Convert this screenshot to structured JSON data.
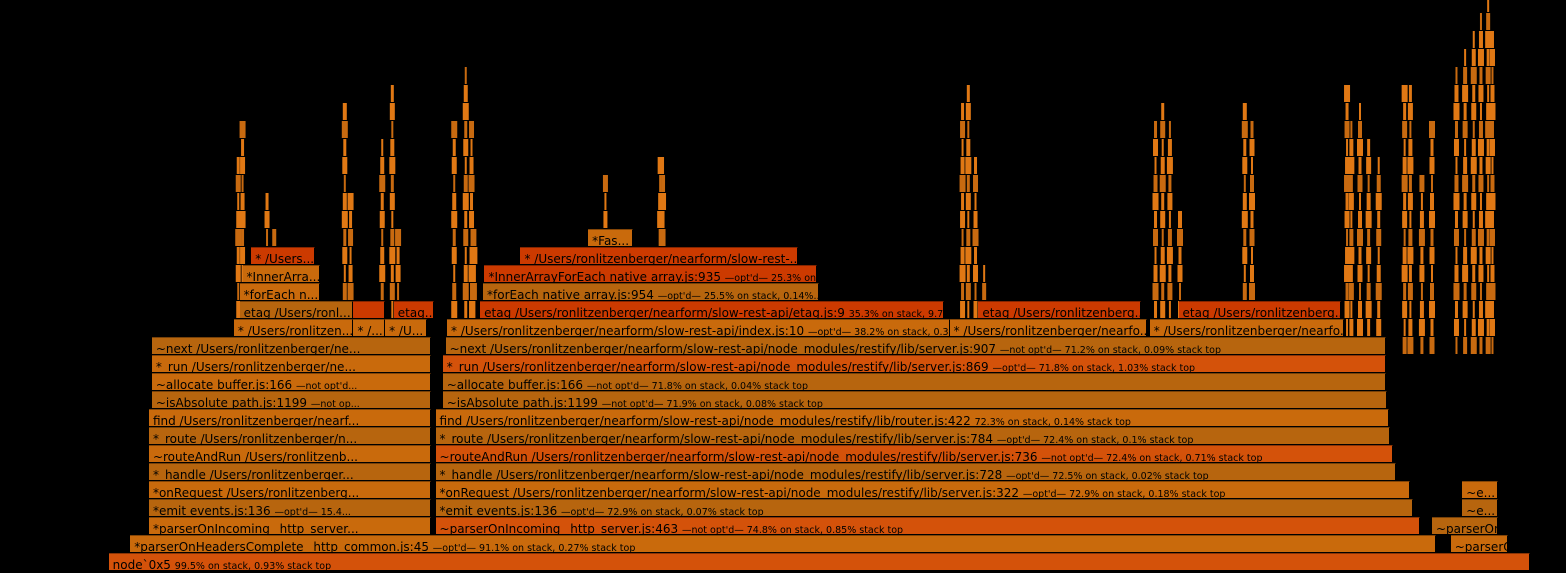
{
  "chart_data": {
    "type": "flamegraph",
    "title": "",
    "colors": {
      "hot": "#cc3a00",
      "warm": "#d4520a",
      "mid": "#c96a0c",
      "cool": "#b7650e",
      "spike": "#e07814",
      "background": "#000000"
    },
    "frames": [
      {
        "depth": 0,
        "start": 0.6,
        "end": 99.3,
        "tone": "warm",
        "name": "node`0x5",
        "meta": "99.5% on stack, 0.93% stack top"
      },
      {
        "depth": 1,
        "start": 2.1,
        "end": 92.8,
        "tone": "mid",
        "name": "*parserOnHeadersComplete _http_common.js:45",
        "meta": "—opt'd— 91.1% on stack, 0.27% stack top"
      },
      {
        "depth": 1,
        "start": 93.8,
        "end": 97.8,
        "tone": "mid",
        "name": "~parserO...",
        "meta": ""
      },
      {
        "depth": 2,
        "start": 3.4,
        "end": 23.0,
        "tone": "mid",
        "name": "*parserOnIncoming _http_server...",
        "meta": ""
      },
      {
        "depth": 2,
        "start": 23.3,
        "end": 91.7,
        "tone": "warm",
        "name": "~parserOnIncoming _http_server.js:463",
        "meta": "—not opt'd— 74.8% on stack, 0.85% stack top"
      },
      {
        "depth": 2,
        "start": 92.5,
        "end": 97.1,
        "tone": "cool",
        "name": "~parserOn...",
        "meta": ""
      },
      {
        "depth": 3,
        "start": 3.4,
        "end": 23.0,
        "tone": "cool",
        "name": "*emit events.js:136",
        "meta": "—opt'd— 15.4..."
      },
      {
        "depth": 3,
        "start": 23.3,
        "end": 91.2,
        "tone": "cool",
        "name": "*emit events.js:136",
        "meta": "—opt'd— 72.9% on stack, 0.07% stack top"
      },
      {
        "depth": 3,
        "start": 94.6,
        "end": 97.1,
        "tone": "cool",
        "name": "~e...",
        "meta": ""
      },
      {
        "depth": 4,
        "start": 3.4,
        "end": 23.0,
        "tone": "mid",
        "name": "*onRequest /Users/ronlitzenberg...",
        "meta": ""
      },
      {
        "depth": 4,
        "start": 23.3,
        "end": 91.0,
        "tone": "mid",
        "name": "*onRequest /Users/ronlitzenberger/nearform/slow-rest-api/node_modules/restify/lib/server.js:322",
        "meta": "—opt'd— 72.9% on stack, 0.18% stack top"
      },
      {
        "depth": 4,
        "start": 94.6,
        "end": 97.1,
        "tone": "mid",
        "name": "~e...",
        "meta": ""
      },
      {
        "depth": 5,
        "start": 3.4,
        "end": 23.0,
        "tone": "cool",
        "name": "*_handle /Users/ronlitzenberger...",
        "meta": ""
      },
      {
        "depth": 5,
        "start": 23.3,
        "end": 90.0,
        "tone": "cool",
        "name": "*_handle /Users/ronlitzenberger/nearform/slow-rest-api/node_modules/restify/lib/server.js:728",
        "meta": "—opt'd— 72.5% on stack, 0.02% stack top"
      },
      {
        "depth": 6,
        "start": 3.4,
        "end": 23.0,
        "tone": "mid",
        "name": "~routeAndRun /Users/ronlitzenb...",
        "meta": ""
      },
      {
        "depth": 6,
        "start": 23.3,
        "end": 89.8,
        "tone": "warm",
        "name": "~routeAndRun /Users/ronlitzenberger/nearform/slow-rest-api/node_modules/restify/lib/server.js:736",
        "meta": "—not opt'd— 72.4% on stack, 0.71% stack top"
      },
      {
        "depth": 7,
        "start": 3.4,
        "end": 23.0,
        "tone": "cool",
        "name": "*_route /Users/ronlitzenberger/n...",
        "meta": ""
      },
      {
        "depth": 7,
        "start": 23.3,
        "end": 89.6,
        "tone": "cool",
        "name": "*_route /Users/ronlitzenberger/nearform/slow-rest-api/node_modules/restify/lib/server.js:784",
        "meta": "—opt'd— 72.4% on stack, 0.1% stack top"
      },
      {
        "depth": 8,
        "start": 3.4,
        "end": 23.0,
        "tone": "mid",
        "name": "find /Users/ronlitzenberger/nearf...",
        "meta": ""
      },
      {
        "depth": 8,
        "start": 23.3,
        "end": 89.5,
        "tone": "mid",
        "name": "find /Users/ronlitzenberger/nearform/slow-rest-api/node_modules/restify/lib/router.js:422",
        "meta": "72.3% on stack, 0.14% stack top"
      },
      {
        "depth": 9,
        "start": 3.6,
        "end": 23.0,
        "tone": "cool",
        "name": "~isAbsolute path.js:1199",
        "meta": "—not op..."
      },
      {
        "depth": 9,
        "start": 23.8,
        "end": 89.4,
        "tone": "cool",
        "name": "~isAbsolute path.js:1199",
        "meta": "—not opt'd— 71.9% on stack, 0.08% stack top"
      },
      {
        "depth": 10,
        "start": 3.6,
        "end": 23.0,
        "tone": "mid",
        "name": "~allocate buffer.js:166",
        "meta": "—not opt'd..."
      },
      {
        "depth": 10,
        "start": 23.8,
        "end": 89.3,
        "tone": "cool",
        "name": "~allocate buffer.js:166",
        "meta": "—not opt'd— 71.8% on stack, 0.04% stack top"
      },
      {
        "depth": 11,
        "start": 3.6,
        "end": 23.0,
        "tone": "mid",
        "name": "*_run /Users/ronlitzenberger/ne...",
        "meta": ""
      },
      {
        "depth": 11,
        "start": 23.8,
        "end": 89.3,
        "tone": "warm",
        "name": "*_run /Users/ronlitzenberger/nearform/slow-rest-api/node_modules/restify/lib/server.js:869",
        "meta": "—opt'd— 71.8% on stack, 1.03% stack top"
      },
      {
        "depth": 12,
        "start": 3.6,
        "end": 23.0,
        "tone": "cool",
        "name": "~next /Users/ronlitzenberger/ne...",
        "meta": ""
      },
      {
        "depth": 12,
        "start": 24.0,
        "end": 89.3,
        "tone": "cool",
        "name": "~next /Users/ronlitzenberger/nearform/slow-rest-api/node_modules/restify/lib/server.js:907",
        "meta": "—not opt'd— 71.2% on stack, 0.09% stack top"
      },
      {
        "depth": 13,
        "start": 9.3,
        "end": 17.6,
        "tone": "mid",
        "name": "* /Users/ronlitzen...",
        "meta": ""
      },
      {
        "depth": 13,
        "start": 17.6,
        "end": 19.8,
        "tone": "mid",
        "name": "* /...",
        "meta": ""
      },
      {
        "depth": 13,
        "start": 19.8,
        "end": 22.7,
        "tone": "mid",
        "name": "* /U...",
        "meta": ""
      },
      {
        "depth": 13,
        "start": 24.1,
        "end": 59.0,
        "tone": "mid",
        "name": "* /Users/ronlitzenberger/nearform/slow-rest-api/index.js:10",
        "meta": "—opt'd— 38.2% on stack, 0.32..."
      },
      {
        "depth": 13,
        "start": 59.0,
        "end": 72.7,
        "tone": "mid",
        "name": "* /Users/ronlitzenberger/nearfo...",
        "meta": ""
      },
      {
        "depth": 13,
        "start": 72.9,
        "end": 86.4,
        "tone": "mid",
        "name": "* /Users/ronlitzenberger/nearfo...",
        "meta": ""
      },
      {
        "depth": 14,
        "start": 9.7,
        "end": 17.6,
        "tone": "cool",
        "name": "etag /Users/ronl...",
        "meta": ""
      },
      {
        "depth": 14,
        "start": 17.6,
        "end": 19.8,
        "tone": "hot",
        "name": "",
        "meta": ""
      },
      {
        "depth": 14,
        "start": 20.4,
        "end": 23.2,
        "tone": "hot",
        "name": "etag...",
        "meta": ""
      },
      {
        "depth": 14,
        "start": 26.4,
        "end": 58.6,
        "tone": "hot",
        "name": "etag /Users/ronlitzenberger/nearform/slow-rest-api/etag.js:9",
        "meta": "35.3% on stack, 9.7..."
      },
      {
        "depth": 14,
        "start": 61.0,
        "end": 72.3,
        "tone": "hot",
        "name": "etag /Users/ronlitzenberg...",
        "meta": ""
      },
      {
        "depth": 14,
        "start": 74.9,
        "end": 86.2,
        "tone": "hot",
        "name": "etag /Users/ronlitzenberg...",
        "meta": ""
      },
      {
        "depth": 15,
        "start": 9.7,
        "end": 15.3,
        "tone": "mid",
        "name": "*forEach n...",
        "meta": ""
      },
      {
        "depth": 15,
        "start": 26.6,
        "end": 49.9,
        "tone": "cool",
        "name": "*forEach native array.js:954",
        "meta": "—opt'd— 25.5% on stack, 0.14%..."
      },
      {
        "depth": 16,
        "start": 9.9,
        "end": 15.3,
        "tone": "mid",
        "name": "*InnerArra...",
        "meta": ""
      },
      {
        "depth": 16,
        "start": 26.7,
        "end": 49.8,
        "tone": "hot",
        "name": "*InnerArrayForEach native array.js:935",
        "meta": "—opt'd— 25.3% on..."
      },
      {
        "depth": 17,
        "start": 10.5,
        "end": 14.9,
        "tone": "hot",
        "name": "* /Users...",
        "meta": ""
      },
      {
        "depth": 17,
        "start": 29.2,
        "end": 48.5,
        "tone": "hot",
        "name": "* /Users/ronlitzenberger/nearform/slow-rest-...",
        "meta": ""
      },
      {
        "depth": 18,
        "start": 33.9,
        "end": 37.0,
        "tone": "mid",
        "name": "*Fas...",
        "meta": ""
      }
    ],
    "spikes": [
      {
        "x": 9.6,
        "h": 22
      },
      {
        "x": 9.9,
        "h": 24
      },
      {
        "x": 10.5,
        "h": 10
      },
      {
        "x": 11.6,
        "h": 20
      },
      {
        "x": 12.1,
        "h": 18
      },
      {
        "x": 14.6,
        "h": 10
      },
      {
        "x": 17.0,
        "h": 25
      },
      {
        "x": 17.4,
        "h": 20
      },
      {
        "x": 19.6,
        "h": 23
      },
      {
        "x": 20.3,
        "h": 26
      },
      {
        "x": 20.7,
        "h": 18
      },
      {
        "x": 24.6,
        "h": 24
      },
      {
        "x": 25.4,
        "h": 27
      },
      {
        "x": 25.8,
        "h": 24
      },
      {
        "x": 26.0,
        "h": 18
      },
      {
        "x": 35.1,
        "h": 21
      },
      {
        "x": 38.9,
        "h": 22
      },
      {
        "x": 39.1,
        "h": 22
      },
      {
        "x": 59.9,
        "h": 25
      },
      {
        "x": 60.3,
        "h": 26
      },
      {
        "x": 60.8,
        "h": 22
      },
      {
        "x": 61.4,
        "h": 16
      },
      {
        "x": 73.3,
        "h": 24
      },
      {
        "x": 73.8,
        "h": 25
      },
      {
        "x": 74.3,
        "h": 24
      },
      {
        "x": 75.0,
        "h": 19
      },
      {
        "x": 79.5,
        "h": 25
      },
      {
        "x": 80.0,
        "h": 24
      },
      {
        "x": 86.6,
        "h": 26
      },
      {
        "x": 86.9,
        "h": 24
      },
      {
        "x": 87.5,
        "h": 25
      },
      {
        "x": 88.1,
        "h": 23
      },
      {
        "x": 88.8,
        "h": 22
      },
      {
        "x": 90.6,
        "h": 26
      },
      {
        "x": 91.0,
        "h": 26
      },
      {
        "x": 91.8,
        "h": 21
      },
      {
        "x": 92.5,
        "h": 24
      },
      {
        "x": 94.2,
        "h": 27
      },
      {
        "x": 94.8,
        "h": 28
      },
      {
        "x": 95.4,
        "h": 29
      },
      {
        "x": 95.9,
        "h": 30
      },
      {
        "x": 96.4,
        "h": 31
      },
      {
        "x": 96.7,
        "h": 29
      }
    ],
    "xlim": [
      0,
      100
    ],
    "max_depth": 31
  }
}
